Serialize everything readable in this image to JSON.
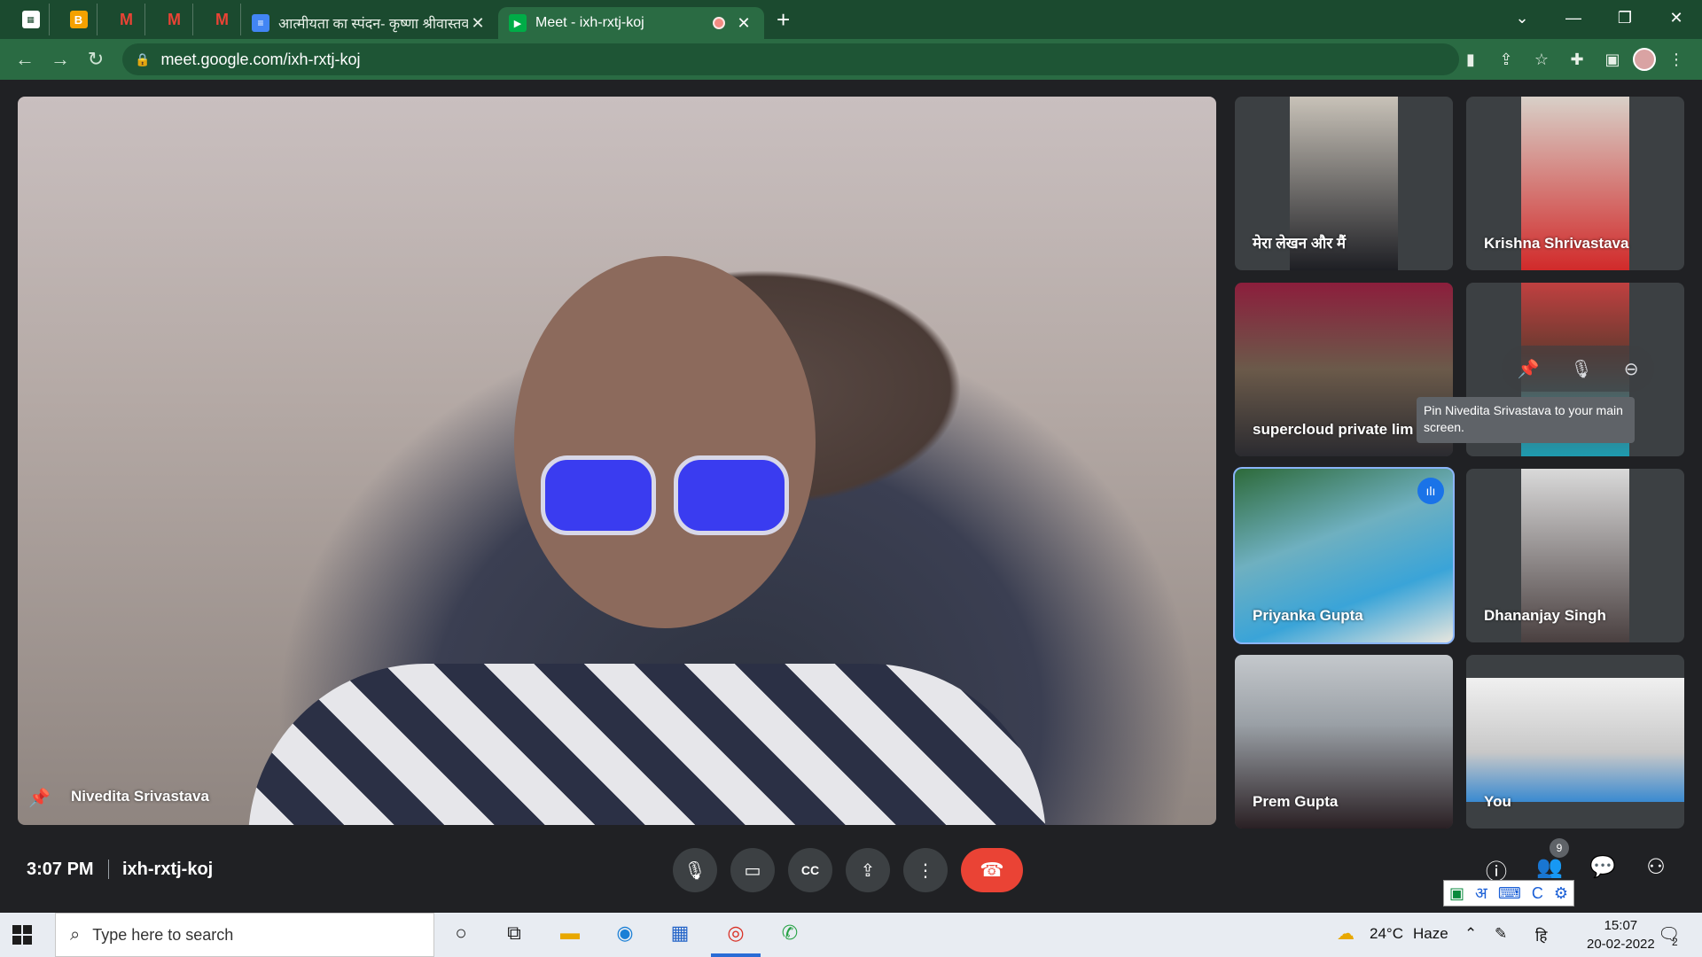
{
  "browser": {
    "pinned_tabs": [
      {
        "icon": "mentions-icon",
        "color": "#ffffff"
      },
      {
        "icon": "blogger-icon",
        "color": "#f4a100"
      },
      {
        "icon": "gmail-icon",
        "color": "#ea4335"
      },
      {
        "icon": "gmail-icon",
        "color": "#ea4335"
      },
      {
        "icon": "gmail-icon",
        "color": "#ea4335"
      }
    ],
    "tabs": [
      {
        "title": "आत्मीयता का स्पंदन- कृष्णा श्रीवास्तव",
        "icon": "docs-icon"
      },
      {
        "title": "Meet - ixh-rxtj-koj",
        "icon": "meet-icon",
        "active": true
      }
    ],
    "url": "meet.google.com/ixh-rxtj-koj"
  },
  "meeting": {
    "main_participant": "Nivedita Srivastava",
    "tooltip": "Pin Nivedita Srivastava to your main screen.",
    "tiles": [
      {
        "label": "मेरा लेखन और मैं"
      },
      {
        "label": "Krishna Shrivastava"
      },
      {
        "label": "supercloud private lim"
      },
      {
        "label": ""
      },
      {
        "label": "Priyanka Gupta",
        "speaking": true
      },
      {
        "label": "Dhananjay Singh"
      },
      {
        "label": "Prem Gupta"
      },
      {
        "label": "You"
      }
    ],
    "time": "3:07 PM",
    "code": "ixh-rxtj-koj",
    "participant_count": "9",
    "accent": "#8ab4f8",
    "end_call_color": "#ea4335"
  },
  "ime": {
    "lang_glyph": "अ",
    "letter": "C"
  },
  "taskbar": {
    "search_placeholder": "Type here to search",
    "weather_temp": "24°C",
    "weather_text": "Haze",
    "lang": "हि",
    "time": "15:07",
    "date": "20-02-2022",
    "notification_count": "2"
  }
}
